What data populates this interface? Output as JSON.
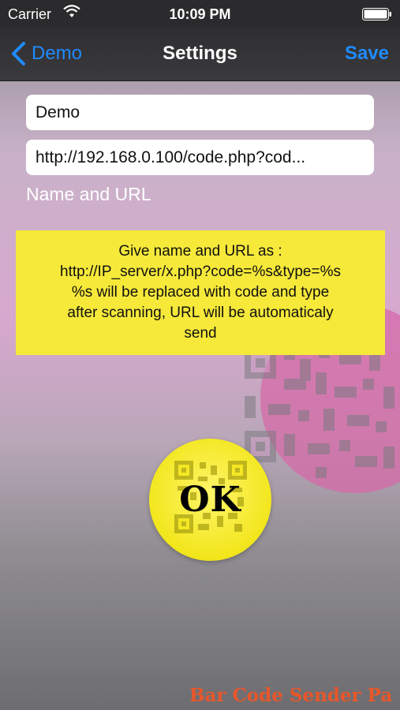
{
  "status_bar": {
    "carrier": "Carrier",
    "time": "10:09 PM"
  },
  "nav": {
    "back_label": "Demo",
    "title": "Settings",
    "save_label": "Save"
  },
  "form": {
    "name_value": "Demo",
    "url_value": "http://192.168.0.100/code.php?cod...",
    "section_label": "Name and URL"
  },
  "info": {
    "lines": [
      "Give name and URL as :",
      "http://IP_server/x.php?code=%s&type=%s",
      "%s will be replaced with code and type",
      "after scanning, URL will be automaticaly",
      "send"
    ]
  },
  "ok_button": {
    "label": "OK"
  },
  "footer": {
    "brand": "Bar Code Sender Pa"
  },
  "colors": {
    "accent": "#1f8bff",
    "info_bg": "#f6e93a",
    "ok_yellow": "#f2e61c",
    "brand": "#e8562a"
  }
}
